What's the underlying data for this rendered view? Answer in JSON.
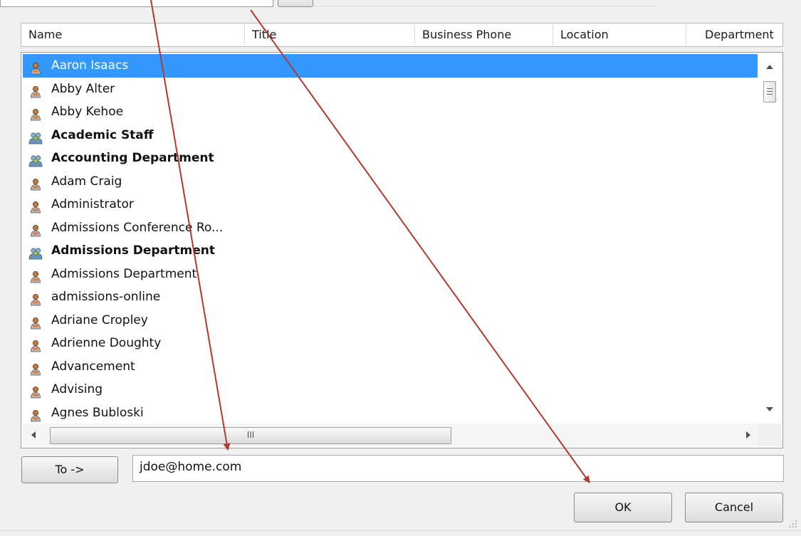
{
  "columns": {
    "name": "Name",
    "title": "Title",
    "business_phone": "Business Phone",
    "location": "Location",
    "department": "Department"
  },
  "rows": [
    {
      "label": "Aaron Isaacs",
      "type": "user",
      "selected": true
    },
    {
      "label": "Abby Alter",
      "type": "user"
    },
    {
      "label": "Abby Kehoe",
      "type": "user"
    },
    {
      "label": "Academic Staff",
      "type": "group"
    },
    {
      "label": "Accounting Department",
      "type": "group"
    },
    {
      "label": "Adam Craig",
      "type": "user"
    },
    {
      "label": "Administrator",
      "type": "user"
    },
    {
      "label": "Admissions Conference Ro...",
      "type": "user"
    },
    {
      "label": "Admissions Department",
      "type": "group"
    },
    {
      "label": "Admissions Department",
      "type": "user"
    },
    {
      "label": "admissions-online",
      "type": "user"
    },
    {
      "label": "Adriane Cropley",
      "type": "user"
    },
    {
      "label": "Adrienne Doughty",
      "type": "user"
    },
    {
      "label": "Advancement",
      "type": "user"
    },
    {
      "label": "Advising",
      "type": "user"
    },
    {
      "label": "Agnes Bubloski",
      "type": "user"
    }
  ],
  "scroll": {
    "h_thumb_grip": "III"
  },
  "recipients": {
    "to_button": "To ->",
    "to_value": "jdoe@home.com"
  },
  "buttons": {
    "ok": "OK",
    "cancel": "Cancel"
  },
  "colors": {
    "selection": "#3399ff",
    "annotation_arrow": "#b03a2e",
    "user_icon": "#c07a40",
    "group_icon": "#5a7fa8"
  },
  "icons": {
    "user": "person-icon",
    "group": "group-icon"
  }
}
